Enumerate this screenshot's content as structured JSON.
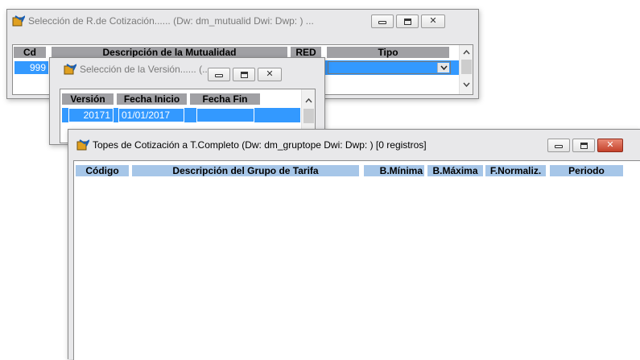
{
  "windows": {
    "mutualidad": {
      "title": "Selección de R.de Cotización...... (Dw: dm_mutualid Dwi:  Dwp: )  ...",
      "columns": {
        "cd": "Cd",
        "descripcion": "Descripción de la Mutualidad",
        "red": "RED",
        "tipo": "Tipo"
      },
      "row": {
        "cd": "999"
      }
    },
    "version": {
      "title": "Selección de la Versión...... (...",
      "columns": {
        "version": "Versión",
        "fecha_inicio": "Fecha Inicio",
        "fecha_fin": "Fecha Fin"
      },
      "row": {
        "version": "20171",
        "fecha_inicio": "01/01/2017",
        "fecha_fin": ""
      }
    },
    "topes": {
      "title": "Topes de Cotización a T.Completo (Dw: dm_gruptope Dwi:  Dwp: )    [0 registros]",
      "columns": {
        "codigo": "Código",
        "descripcion": "Descripción del Grupo de Tarifa",
        "bmin": "B.Mínima",
        "bmax": "B.Máxima",
        "fnorm": "F.Normaliz.",
        "periodo": "Periodo"
      }
    }
  },
  "icons": {
    "app": "app-window-icon",
    "minimize": "minimize-icon",
    "maximize": "maximize-icon",
    "close": "close-icon",
    "dropdown": "chevron-down-icon",
    "scroll_up": "scroll-up-icon",
    "scroll_down": "scroll-down-icon"
  },
  "colors": {
    "selection": "#3399ff",
    "header": "#a0a0a4",
    "close_active": "#c4422b"
  }
}
